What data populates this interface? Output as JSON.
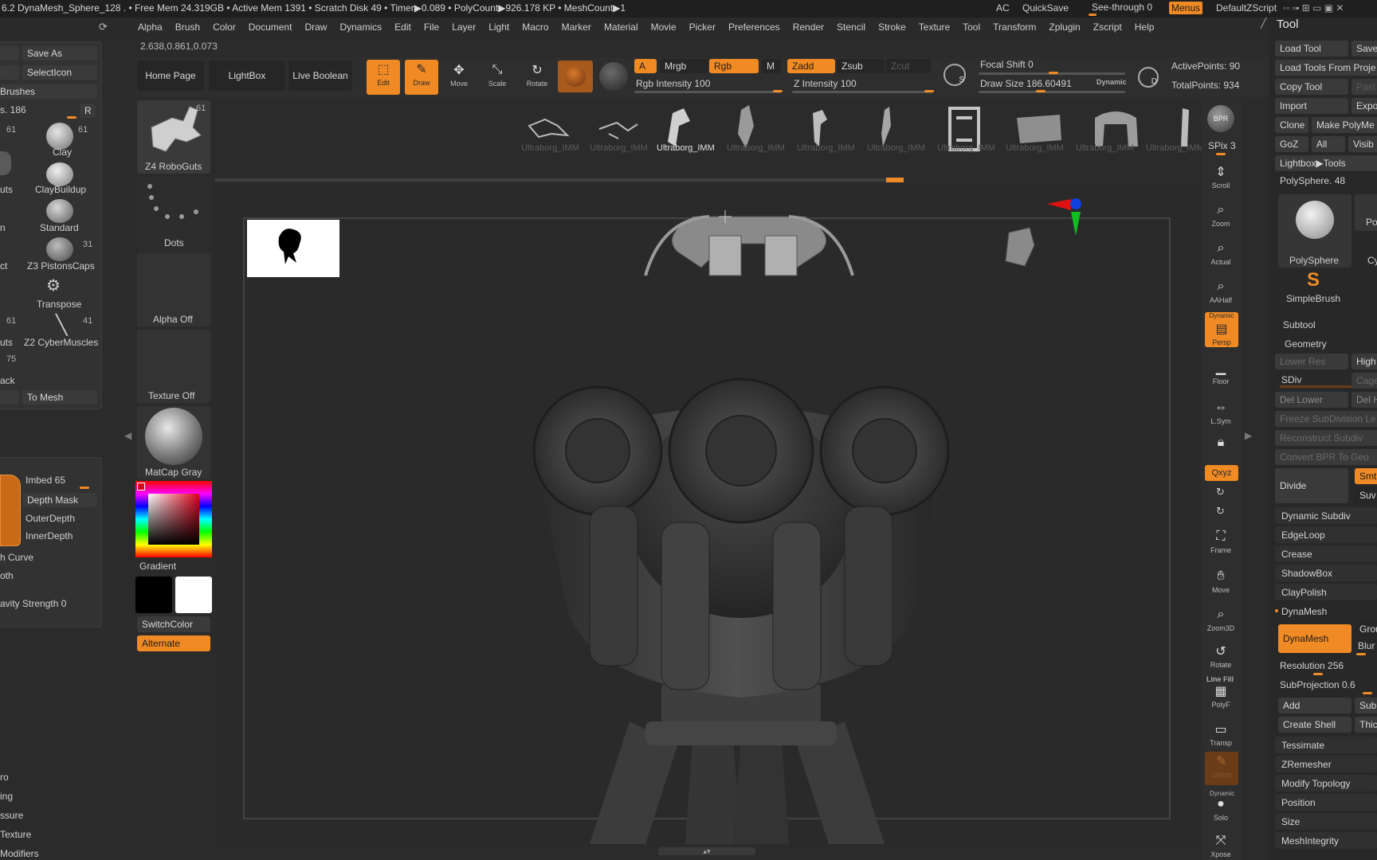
{
  "titlebar": {
    "text": "6.2   DynaMesh_Sphere_128   . • Free Mem 24.319GB • Active Mem 1391 • Scratch Disk 49 •  Timer▶0.089 • PolyCount▶926.178 KP  • MeshCount▶1",
    "ac": "AC",
    "quicksave": "QuickSave",
    "see_through": "See-through  0",
    "menus": "Menus",
    "default_zscript": "DefaultZScript"
  },
  "menubar": [
    "Alpha",
    "Brush",
    "Color",
    "Document",
    "Draw",
    "Dynamics",
    "Edit",
    "File",
    "Layer",
    "Light",
    "Macro",
    "Marker",
    "Material",
    "Movie",
    "Picker",
    "Preferences",
    "Render",
    "Stencil",
    "Stroke",
    "Texture",
    "Tool",
    "Transform",
    "Zplugin",
    "Zscript",
    "Help"
  ],
  "coords": "2.638,0.861,0.073",
  "shelf": {
    "home_page": "Home Page",
    "lightbox": "LightBox",
    "live_boolean": "Live Boolean",
    "edit": "Edit",
    "draw": "Draw",
    "move": "Move",
    "scale": "Scale",
    "rotate": "Rotate",
    "a": "A",
    "mrgb": "Mrgb",
    "rgb": "Rgb",
    "m": "M",
    "zadd": "Zadd",
    "zsub": "Zsub",
    "zcut": "Zcut",
    "rgb_intensity": "Rgb Intensity 100",
    "z_intensity": "Z Intensity 100",
    "focal_shift": "Focal Shift 0",
    "draw_size": "Draw Size 186.60491",
    "dynamic": "Dynamic",
    "active_points": "ActivePoints: 90",
    "total_points": "TotalPoints: 934",
    "s_label": "S",
    "d_label": "D"
  },
  "brush_strip": {
    "selected": "Ultraborg_IMM",
    "items": [
      "Ultraborg_IMM",
      "Ultraborg_IMM",
      "Ultraborg_IMM",
      "Ultraborg_IMM",
      "Ultraborg_IMM",
      "Ultraborg_IMM",
      "Ultraborg_IMM",
      "Ultraborg_IMM",
      "Ultraborg_IMM",
      "Ultraborg_IMM"
    ]
  },
  "left_panel": {
    "save_as": "Save As",
    "select_icon": "SelectIcon",
    "brushes": "Brushes",
    "size_label": "s. 186",
    "r": "R",
    "brushes_list": [
      {
        "name": "Clay",
        "count": "61"
      },
      {
        "name": "ClayBuildup",
        "count": ""
      },
      {
        "name": "Standard",
        "count": ""
      },
      {
        "name": "Z3 PistonsCaps",
        "count": "31"
      },
      {
        "name": "Transpose",
        "count": ""
      },
      {
        "name": "Z2 CyberMuscles",
        "count": "41"
      }
    ],
    "left_counts": [
      "61",
      "61",
      "75"
    ],
    "left_labels": [
      "uts",
      "n",
      "ct",
      "uts",
      "ack"
    ],
    "to_mesh": "To Mesh",
    "imbed": "Imbed 65",
    "depth_mask": "Depth Mask",
    "outer_depth": "OuterDepth",
    "inner_depth": "InnerDepth",
    "h_curve": "h Curve",
    "oth": "oth",
    "gravity": "avity Strength 0",
    "bottom_items": [
      "ro",
      "ing",
      "ssure",
      "Texture",
      "Modifiers"
    ]
  },
  "mid_panel": {
    "current_tool": "Z4 RoboGuts",
    "tool_count": "61",
    "stroke": "Dots",
    "alpha": "Alpha Off",
    "texture": "Texture Off",
    "material": "MatCap Gray",
    "gradient": "Gradient",
    "switch_color": "SwitchColor",
    "alternate": "Alternate"
  },
  "right_toolbar": {
    "bpr": "BPR",
    "spix": "SPix 3",
    "items": [
      "Scroll",
      "Zoom",
      "Actual",
      "AAHalf",
      "Persp",
      "Floor",
      "L.Sym",
      "",
      "Qxyz",
      "",
      "",
      "Frame",
      "Move",
      "Zoom3D",
      "Rotate",
      "PolyF",
      "Transp",
      "Ghost",
      "Solo",
      "Xpose"
    ],
    "dynamic_label": "Dynamic",
    "line_fill": "Line Fill"
  },
  "tool_panel": {
    "title": "Tool",
    "load_tool": "Load Tool",
    "save": "Save",
    "load_tools_from_project": "Load Tools From Proje",
    "copy_tool": "Copy Tool",
    "paste": "Past",
    "import": "Import",
    "export": "Expo",
    "clone": "Clone",
    "make_polymesh": "Make PolyMe",
    "goz": "GoZ",
    "all": "All",
    "visible": "Visib",
    "lightbox_tools": "Lightbox▶Tools",
    "polysphere_label": "PolySphere. 48",
    "polysphere": "PolySphere",
    "simplebrush": "SimpleBrush",
    "po": "Po",
    "cy": "Cy",
    "subtool": "Subtool",
    "geometry": "Geometry",
    "lower_res": "Lower Res",
    "higher": "High",
    "sdiv": "SDiv",
    "cage": "Cage",
    "del_lower": "Del Lower",
    "del_higher": "Del H",
    "freeze": "Freeze SubDivision Le",
    "reconstruct": "Reconstruct Subdiv",
    "convert_bpr": "Convert BPR To Geo",
    "divide": "Divide",
    "smt": "Smt",
    "suv": "Suv",
    "dynamic_subdiv": "Dynamic Subdiv",
    "edgeloop": "EdgeLoop",
    "crease": "Crease",
    "shadowbox": "ShadowBox",
    "claypolish": "ClayPolish",
    "dynamesh_header": "DynaMesh",
    "dynamesh_btn": "DynaMesh",
    "groups": "Grou",
    "blur": "Blur",
    "resolution": "Resolution 256",
    "subprojection": "SubProjection 0.6",
    "add": "Add",
    "sub": "Sub",
    "create_shell": "Create Shell",
    "thickness": "Thick",
    "items": [
      "Tessimate",
      "ZRemesher",
      "Modify Topology",
      "Position",
      "Size",
      "MeshIntegrity"
    ]
  }
}
